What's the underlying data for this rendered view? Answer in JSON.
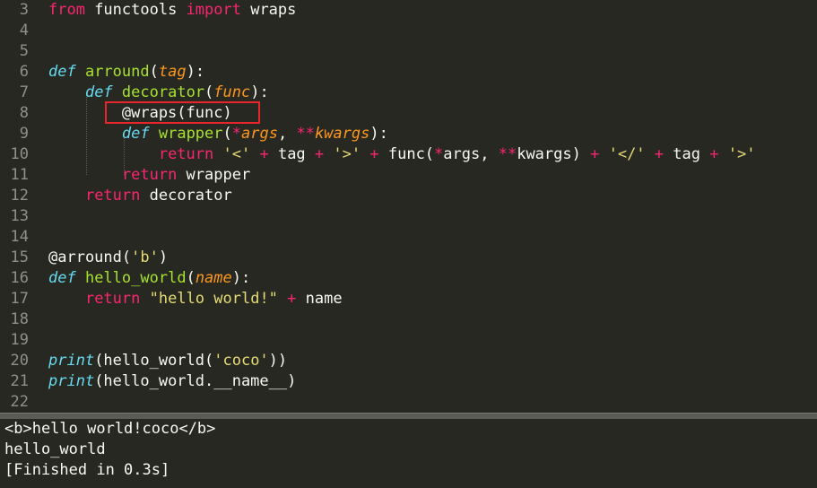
{
  "editor": {
    "lines": [
      {
        "num": "3",
        "tokens": [
          [
            "kw",
            "from"
          ],
          [
            "plain",
            " functools "
          ],
          [
            "kw",
            "import"
          ],
          [
            "plain",
            " wraps"
          ]
        ]
      },
      {
        "num": "4",
        "tokens": []
      },
      {
        "num": "5",
        "tokens": []
      },
      {
        "num": "6",
        "tokens": [
          [
            "def",
            "def"
          ],
          [
            "plain",
            " "
          ],
          [
            "fn",
            "arround"
          ],
          [
            "plain",
            "("
          ],
          [
            "par",
            "tag"
          ],
          [
            "plain",
            "):"
          ]
        ]
      },
      {
        "num": "7",
        "tokens": [
          [
            "plain",
            "    "
          ],
          [
            "def",
            "def"
          ],
          [
            "plain",
            " "
          ],
          [
            "fn",
            "decorator"
          ],
          [
            "plain",
            "("
          ],
          [
            "par",
            "func"
          ],
          [
            "plain",
            "):"
          ]
        ]
      },
      {
        "num": "8",
        "tokens": [
          [
            "plain",
            "        @wraps(func)"
          ]
        ]
      },
      {
        "num": "9",
        "tokens": [
          [
            "plain",
            "        "
          ],
          [
            "def",
            "def"
          ],
          [
            "plain",
            " "
          ],
          [
            "fn",
            "wrapper"
          ],
          [
            "plain",
            "("
          ],
          [
            "kw",
            "*"
          ],
          [
            "par",
            "args"
          ],
          [
            "plain",
            ", "
          ],
          [
            "kw",
            "**"
          ],
          [
            "par",
            "kwargs"
          ],
          [
            "plain",
            "):"
          ]
        ]
      },
      {
        "num": "10",
        "tokens": [
          [
            "plain",
            "            "
          ],
          [
            "kw",
            "return"
          ],
          [
            "plain",
            " "
          ],
          [
            "str",
            "'<'"
          ],
          [
            "plain",
            " "
          ],
          [
            "kw",
            "+"
          ],
          [
            "plain",
            " tag "
          ],
          [
            "kw",
            "+"
          ],
          [
            "plain",
            " "
          ],
          [
            "str",
            "'>'"
          ],
          [
            "plain",
            " "
          ],
          [
            "kw",
            "+"
          ],
          [
            "plain",
            " func("
          ],
          [
            "kw",
            "*"
          ],
          [
            "plain",
            "args, "
          ],
          [
            "kw",
            "**"
          ],
          [
            "plain",
            "kwargs) "
          ],
          [
            "kw",
            "+"
          ],
          [
            "plain",
            " "
          ],
          [
            "str",
            "'</'"
          ],
          [
            "plain",
            " "
          ],
          [
            "kw",
            "+"
          ],
          [
            "plain",
            " tag "
          ],
          [
            "kw",
            "+"
          ],
          [
            "plain",
            " "
          ],
          [
            "str",
            "'>'"
          ]
        ]
      },
      {
        "num": "11",
        "tokens": [
          [
            "plain",
            "        "
          ],
          [
            "kw",
            "return"
          ],
          [
            "plain",
            " wrapper"
          ]
        ]
      },
      {
        "num": "12",
        "tokens": [
          [
            "plain",
            "    "
          ],
          [
            "kw",
            "return"
          ],
          [
            "plain",
            " decorator"
          ]
        ]
      },
      {
        "num": "13",
        "tokens": []
      },
      {
        "num": "14",
        "tokens": []
      },
      {
        "num": "15",
        "tokens": [
          [
            "plain",
            "@arround("
          ],
          [
            "str",
            "'b'"
          ],
          [
            "plain",
            ")"
          ]
        ]
      },
      {
        "num": "16",
        "tokens": [
          [
            "def",
            "def"
          ],
          [
            "plain",
            " "
          ],
          [
            "fn",
            "hello_world"
          ],
          [
            "plain",
            "("
          ],
          [
            "par",
            "name"
          ],
          [
            "plain",
            "):"
          ]
        ]
      },
      {
        "num": "17",
        "tokens": [
          [
            "plain",
            "    "
          ],
          [
            "kw",
            "return"
          ],
          [
            "plain",
            " "
          ],
          [
            "str",
            "\"hello world!\""
          ],
          [
            "plain",
            " "
          ],
          [
            "kw",
            "+"
          ],
          [
            "plain",
            " name"
          ]
        ]
      },
      {
        "num": "18",
        "tokens": []
      },
      {
        "num": "19",
        "tokens": []
      },
      {
        "num": "20",
        "tokens": [
          [
            "def",
            "print"
          ],
          [
            "plain",
            "(hello_world("
          ],
          [
            "str",
            "'coco'"
          ],
          [
            "plain",
            "))"
          ]
        ]
      },
      {
        "num": "21",
        "tokens": [
          [
            "def",
            "print"
          ],
          [
            "plain",
            "(hello_world.__name__)"
          ]
        ]
      },
      {
        "num": "22",
        "tokens": []
      }
    ]
  },
  "output": {
    "lines": [
      "<b>hello world!coco</b>",
      "hello_world",
      "[Finished in 0.3s]"
    ]
  },
  "colors": {
    "background": "#272822",
    "keyword": "#f92672",
    "builtin": "#66d9ef",
    "function": "#a6e22e",
    "parameter": "#fd971f",
    "string": "#e6db74",
    "highlight_box": "#e8252a"
  }
}
